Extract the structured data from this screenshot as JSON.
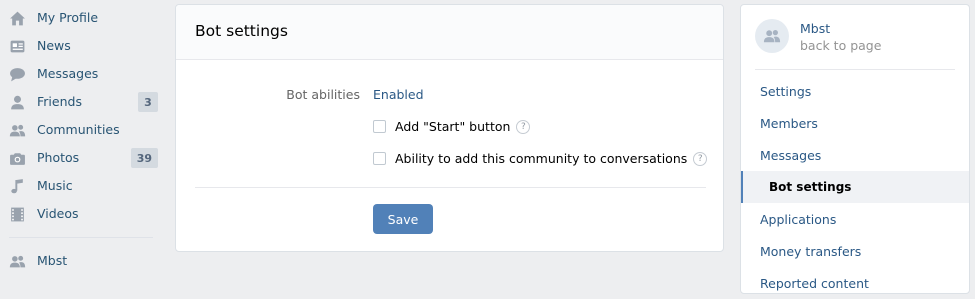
{
  "left_nav": {
    "items": [
      {
        "label": "My Profile",
        "icon": "home-icon"
      },
      {
        "label": "News",
        "icon": "news-icon"
      },
      {
        "label": "Messages",
        "icon": "messages-icon"
      },
      {
        "label": "Friends",
        "icon": "friend-icon",
        "count": "3"
      },
      {
        "label": "Communities",
        "icon": "communities-icon"
      },
      {
        "label": "Photos",
        "icon": "camera-icon",
        "count": "39"
      },
      {
        "label": "Music",
        "icon": "music-note-icon"
      },
      {
        "label": "Videos",
        "icon": "film-icon"
      }
    ],
    "group": {
      "label": "Mbst",
      "icon": "communities-icon"
    }
  },
  "main": {
    "title": "Bot settings",
    "abilities_label": "Bot abilities",
    "abilities_value": "Enabled",
    "start_button_label": "Add \"Start\" button",
    "conversations_label": "Ability to add this community to conversations",
    "help_glyph": "?",
    "save_label": "Save"
  },
  "right_menu": {
    "community_name": "Mbst",
    "back_label": "back to page",
    "items": [
      {
        "label": "Settings"
      },
      {
        "label": "Members"
      },
      {
        "label": "Messages"
      },
      {
        "label": "Bot settings",
        "active": true
      },
      {
        "label": "Applications"
      },
      {
        "label": "Money transfers"
      },
      {
        "label": "Reported content"
      }
    ]
  },
  "colors": {
    "accent": "#5181b8",
    "link": "#2a5885",
    "icon": "#99a2ad",
    "background": "#edeef0"
  }
}
